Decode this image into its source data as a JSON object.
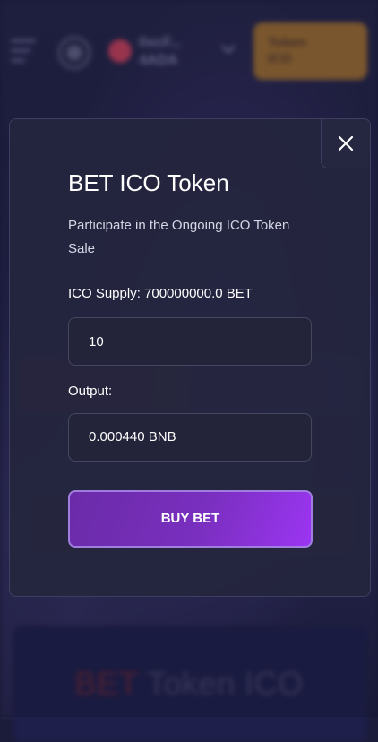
{
  "header": {
    "wallet_address": "0xcF...\n4ADA",
    "token_ico_button_label": "Token\nICO"
  },
  "background": {
    "section_title_accent": "BET",
    "section_title_rest": " Token ICO"
  },
  "modal": {
    "title": "BET ICO Token",
    "subtitle": "Participate in the Ongoing ICO Token Sale",
    "supply_label": "ICO Supply: 700000000.0 BET",
    "amount_value": "10",
    "output_label": "Output:",
    "output_value": "0.000440 BNB",
    "buy_button_label": "BUY BET"
  },
  "colors": {
    "accent_purple": "#7a2fbf",
    "token_button_orange": "#b07a2d",
    "avatar_red": "#e0455f"
  },
  "icons": [
    "hamburger-menu-icon",
    "logo-icon",
    "chevron-down-icon",
    "close-icon"
  ]
}
